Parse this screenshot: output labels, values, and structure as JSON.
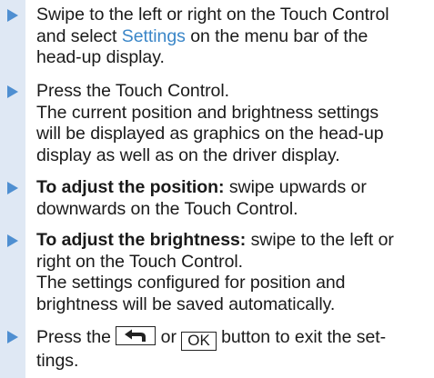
{
  "steps": [
    {
      "lines": [
        {
          "before": "Swipe to the left or right on the Touch Control"
        },
        {
          "before": "and select ",
          "link": "Settings",
          "after": " on the menu bar of the"
        },
        {
          "before": "head-up display."
        }
      ]
    },
    {
      "lines": [
        {
          "before": "Press the Touch Control."
        },
        {
          "before": "The current position and brightness settings"
        },
        {
          "before": "will be displayed as graphics on the head-up"
        },
        {
          "before": "display as well as on the driver display."
        }
      ]
    },
    {
      "lines": [
        {
          "bold": "To adjust the position:",
          "after": " swipe upwards or"
        },
        {
          "before": "downwards on the Touch Control."
        }
      ]
    },
    {
      "lines": [
        {
          "bold": "To adjust the brightness:",
          "after": " swipe to the left or"
        },
        {
          "before": "right on the Touch Control."
        },
        {
          "before": "The settings configured for position and"
        },
        {
          "before": "brightness will be saved automatically."
        }
      ]
    },
    {
      "line1": {
        "before": "Press the ",
        "middle": " or ",
        "after": " button to exit the set-"
      },
      "back_button_icon": "back-arrow-icon",
      "ok_button_label": "OK",
      "line2": "tings."
    }
  ],
  "colors": {
    "accent": "#4f8fd1",
    "link": "#3a86c8",
    "sidebar": "#dfe8f4"
  }
}
